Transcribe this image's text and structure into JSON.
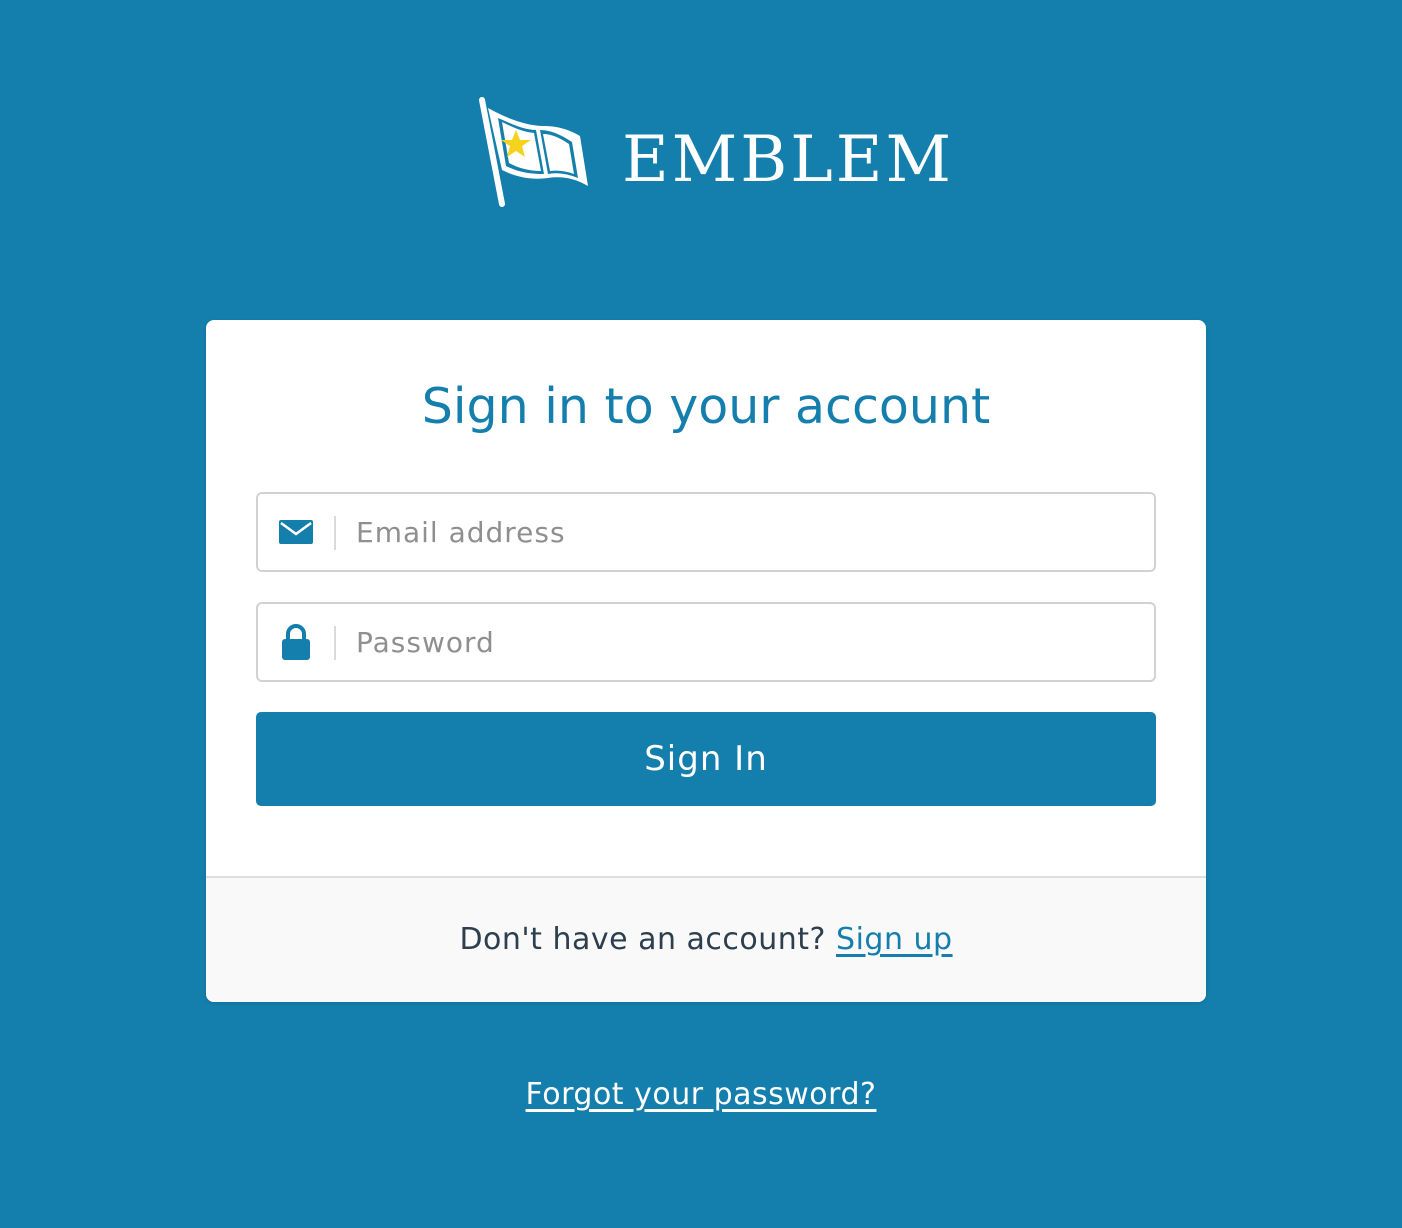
{
  "brand": {
    "name": "EMBLEM",
    "logo_icon": "flag-star-icon",
    "star_color": "#f4d21e"
  },
  "colors": {
    "background": "#147eac",
    "accent": "#147eac",
    "card": "#ffffff",
    "footer_bg": "#f9f9f9"
  },
  "signin": {
    "title": "Sign in to your account",
    "email": {
      "placeholder": "Email address",
      "value": "",
      "icon": "envelope-icon"
    },
    "password": {
      "placeholder": "Password",
      "value": "",
      "icon": "lock-icon"
    },
    "submit_label": "Sign In"
  },
  "footer": {
    "prompt": "Don't have an account?",
    "signup_label": "Sign up"
  },
  "forgot_label": "Forgot your password?"
}
